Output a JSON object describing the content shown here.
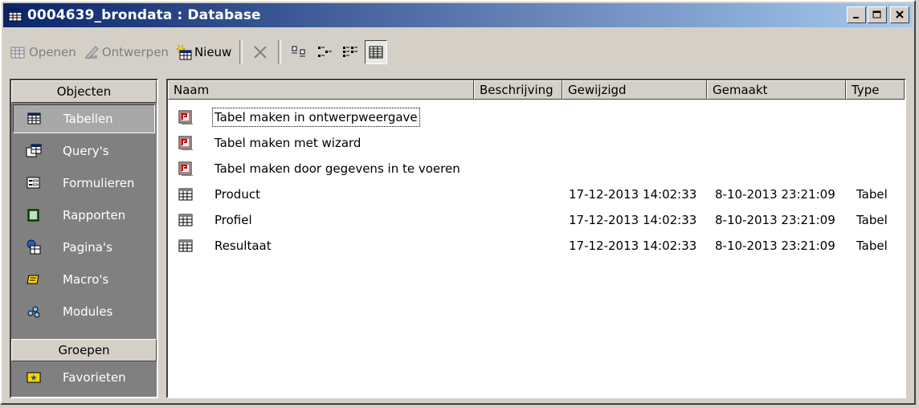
{
  "window": {
    "title": "0004639_brondata : Database"
  },
  "title_buttons": {
    "minimize": "_",
    "maximize": "□",
    "close": "×"
  },
  "toolbar": {
    "open_label": "Openen",
    "design_label": "Ontwerpen",
    "new_label": "Nieuw"
  },
  "sidebar": {
    "objects_header": "Objecten",
    "groups_header": "Groepen",
    "items": [
      {
        "label": "Tabellen",
        "icon": "table-icon",
        "selected": true
      },
      {
        "label": "Query's",
        "icon": "query-icon"
      },
      {
        "label": "Formulieren",
        "icon": "form-icon"
      },
      {
        "label": "Rapporten",
        "icon": "report-icon"
      },
      {
        "label": "Pagina's",
        "icon": "page-icon"
      },
      {
        "label": "Macro's",
        "icon": "macro-icon"
      },
      {
        "label": "Modules",
        "icon": "module-icon"
      }
    ],
    "group_items": [
      {
        "label": "Favorieten",
        "icon": "favorites-icon"
      }
    ]
  },
  "columns": [
    "Naam",
    "Beschrijving",
    "Gewijzigd",
    "Gemaakt",
    "Type"
  ],
  "rows": [
    {
      "name": "Tabel maken in ontwerpweergave",
      "icon": "shortcut-icon",
      "modified": "",
      "created": "",
      "type": ""
    },
    {
      "name": "Tabel maken met wizard",
      "icon": "shortcut-icon",
      "modified": "",
      "created": "",
      "type": ""
    },
    {
      "name": "Tabel maken door gegevens in te voeren",
      "icon": "shortcut-icon",
      "modified": "",
      "created": "",
      "type": ""
    },
    {
      "name": "Product",
      "icon": "table-icon",
      "modified": "17-12-2013 14:02:33",
      "created": "8-10-2013 23:21:09",
      "type": "Tabel"
    },
    {
      "name": "Profiel",
      "icon": "table-icon",
      "modified": "17-12-2013 14:02:33",
      "created": "8-10-2013 23:21:09",
      "type": "Tabel"
    },
    {
      "name": "Resultaat",
      "icon": "table-icon",
      "modified": "17-12-2013 14:02:33",
      "created": "8-10-2013 23:21:09",
      "type": "Tabel"
    }
  ]
}
